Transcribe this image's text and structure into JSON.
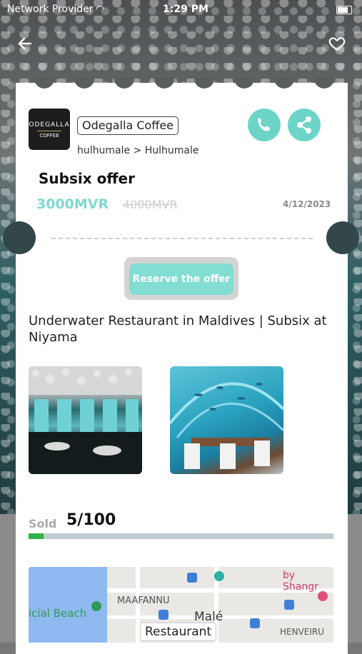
{
  "status_bar": {
    "carrier": "Network Provider",
    "time": "1:29 PM"
  },
  "nav": {
    "back_icon": "arrow-left-icon",
    "favorite_icon": "heart-icon"
  },
  "merchant": {
    "logo_line1": "ODEGALLA",
    "logo_line2": "COFFEE",
    "name": "Odegalla Coffee",
    "location": "hulhumale > Hulhumale"
  },
  "actions": {
    "call_icon": "phone-icon",
    "share_icon": "share-icon"
  },
  "offer": {
    "title": "Subsix offer",
    "price": "3000MVR",
    "old_price": "4000MVR",
    "date": "4/12/2023",
    "reserve_label": "Reserve the offer",
    "description": "Underwater Restaurant in Maldives | Subsix at Niyama"
  },
  "gallery": {
    "photo_1": "restaurant-interior-photo",
    "photo_2": "underwater-dining-photo"
  },
  "sold": {
    "label": "Sold",
    "value": "5/100",
    "fraction": 0.05
  },
  "map": {
    "labels": {
      "beach": "icial Beach",
      "district": "MAAFANNU",
      "city": "Malé",
      "area": "HENVEIRU",
      "hotel": "by Shangr"
    },
    "pin_label": "Restaurant"
  },
  "colors": {
    "accent": "#6dd4c8",
    "progress": "#2fb34a"
  }
}
